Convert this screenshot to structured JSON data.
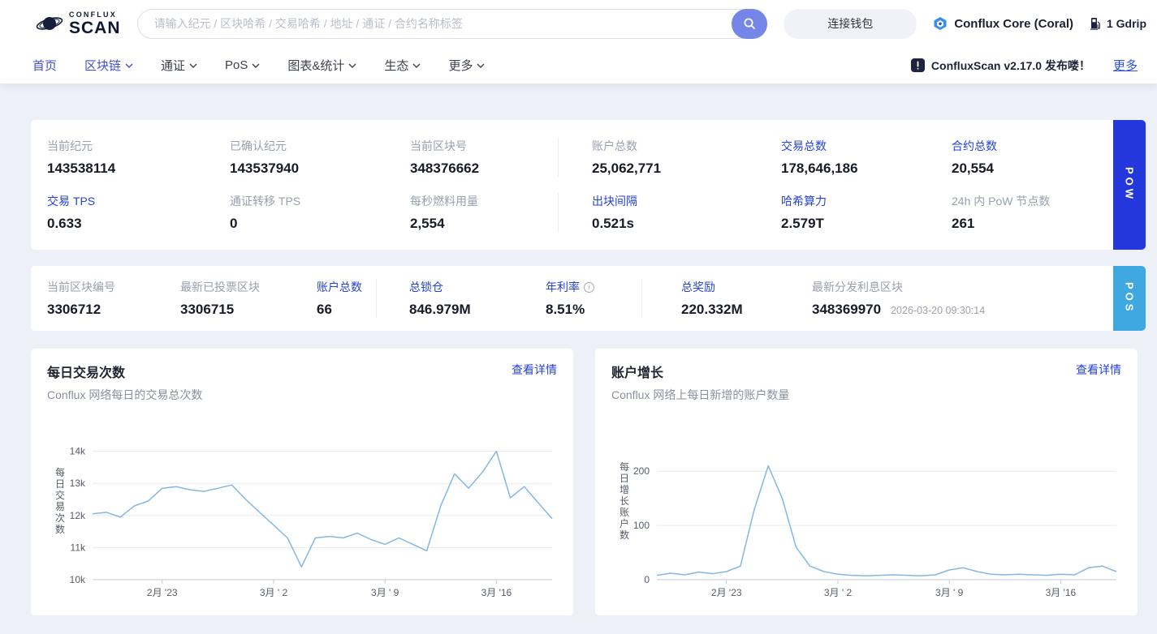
{
  "colors": {
    "primary_blue": "#2442dd",
    "pow_tab": "#2337dd",
    "pos_tab": "#3fa8e0",
    "chart_line": "#84b7e3"
  },
  "header": {
    "logo_top": "CONFLUX",
    "logo_bottom": "SCAN",
    "search_placeholder": "请输入纪元 / 区块哈希 / 交易哈希 / 地址 / 通证 / 合约名称标签",
    "connect_wallet": "连接钱包",
    "network_label": "Conflux Core (Coral)",
    "gas_price": "1 Gdrip"
  },
  "nav": {
    "items": [
      "首页",
      "区块链",
      "通证",
      "PoS",
      "图表&统计",
      "生态",
      "更多"
    ],
    "announcement": "ConfluxScan v2.17.0 发布喽！",
    "more": "更多"
  },
  "pow_panel": {
    "tab": "POW",
    "stats": [
      {
        "label": "当前纪元",
        "value": "143538114",
        "link": false
      },
      {
        "label": "已确认纪元",
        "value": "143537940",
        "link": false
      },
      {
        "label": "当前区块号",
        "value": "348376662",
        "link": false
      },
      {
        "label": "账户总数",
        "value": "25,062,771",
        "link": false
      },
      {
        "label": "交易总数",
        "value": "178,646,186",
        "link": true
      },
      {
        "label": "合约总数",
        "value": "20,554",
        "link": true
      },
      {
        "label": "交易 TPS",
        "value": "0.633",
        "link": true
      },
      {
        "label": "通证转移 TPS",
        "value": "0",
        "link": false
      },
      {
        "label": "每秒燃料用量",
        "value": "2,554",
        "link": false
      },
      {
        "label": "出块间隔",
        "value": "0.521s",
        "link": true
      },
      {
        "label": "哈希算力",
        "value": "2.579T",
        "link": true
      },
      {
        "label": "24h 内 PoW 节点数",
        "value": "261",
        "link": false
      }
    ]
  },
  "pos_panel": {
    "tab": "POS",
    "stats": [
      {
        "label": "当前区块编号",
        "value": "3306712",
        "link": false
      },
      {
        "label": "最新已投票区块",
        "value": "3306715",
        "link": false
      },
      {
        "label": "账户总数",
        "value": "66",
        "link": true
      },
      {
        "label": "总锁仓",
        "value": "846.979M",
        "link": true
      },
      {
        "label": "年利率",
        "value": "8.51%",
        "link": true,
        "info": true
      },
      {
        "label": "总奖励",
        "value": "220.332M",
        "link": true
      },
      {
        "label": "最新分发利息区块",
        "value": "348369970",
        "link": false,
        "timestamp": "2026-03-20 09:30:14"
      }
    ]
  },
  "chart_data": [
    {
      "type": "line",
      "title": "每日交易次数",
      "subtitle": "Conflux 网络每日的交易总次数",
      "detail_link": "查看详情",
      "ylabel": "每日交易次数",
      "xlabel": "",
      "ylim": [
        10000,
        14900
      ],
      "grid": true,
      "legend": "none",
      "line_color": "#84b7e3",
      "yticks": [
        {
          "value": 10000,
          "label": "10k"
        },
        {
          "value": 11000,
          "label": "11k"
        },
        {
          "value": 12000,
          "label": "12k"
        },
        {
          "value": 13000,
          "label": "13k"
        },
        {
          "value": 14000,
          "label": "14k"
        }
      ],
      "xticks": [
        {
          "index": 5,
          "label": "2月 '23"
        },
        {
          "index": 13,
          "label": "3月 ' 2"
        },
        {
          "index": 21,
          "label": "3月 ' 9"
        },
        {
          "index": 29,
          "label": "3月 '16"
        }
      ],
      "values": [
        12050,
        12100,
        11950,
        12300,
        12450,
        12850,
        12900,
        12800,
        12750,
        12850,
        12950,
        12500,
        12100,
        11700,
        11300,
        10400,
        11300,
        11350,
        11300,
        11450,
        11250,
        11100,
        11300,
        11100,
        10900,
        12300,
        13300,
        12850,
        13350,
        14000,
        12550,
        12900,
        12400,
        11900
      ]
    },
    {
      "type": "line",
      "title": "账户增长",
      "subtitle": "Conflux 网络上每日新增的账户数量",
      "detail_link": "查看详情",
      "ylabel": "每日增长账户数",
      "xlabel": "",
      "ylim": [
        0,
        290
      ],
      "grid": true,
      "legend": "none",
      "line_color": "#84b7e3",
      "yticks": [
        {
          "value": 0,
          "label": "0"
        },
        {
          "value": 100,
          "label": "100"
        },
        {
          "value": 200,
          "label": "200"
        }
      ],
      "xticks": [
        {
          "index": 5,
          "label": "2月 '23"
        },
        {
          "index": 13,
          "label": "3月 ' 2"
        },
        {
          "index": 21,
          "label": "3月 ' 9"
        },
        {
          "index": 29,
          "label": "3月 '16"
        }
      ],
      "values": [
        8,
        12,
        9,
        14,
        11,
        15,
        25,
        130,
        210,
        150,
        60,
        25,
        15,
        10,
        8,
        7,
        8,
        9,
        8,
        7,
        9,
        18,
        22,
        15,
        10,
        9,
        10,
        9,
        8,
        10,
        9,
        22,
        25,
        15
      ]
    }
  ]
}
